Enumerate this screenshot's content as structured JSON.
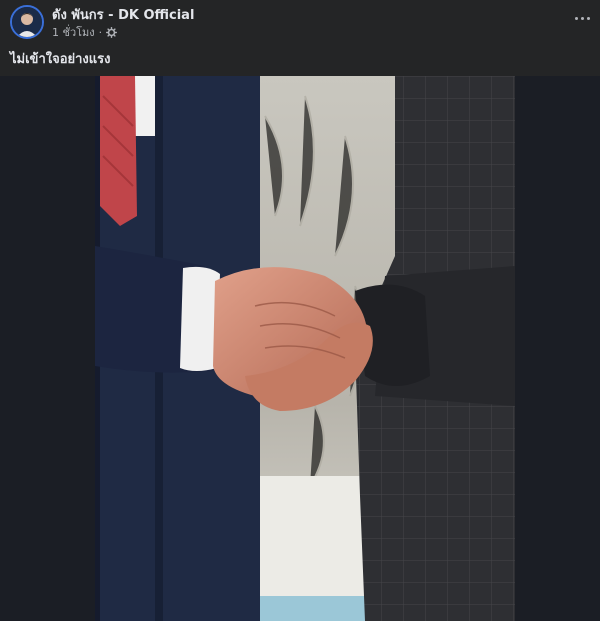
{
  "post": {
    "author": "ดัง พันกร - DK Official",
    "timestamp": "1 ชั่วโมง",
    "separator": "·",
    "privacy_icon": "gear-icon",
    "caption": "ไม่เข้าใจอย่างแรง",
    "more_icon": "more-horizontal-icon",
    "avatar_icon": "avatar"
  },
  "photo": {
    "subject": "handshake-photo",
    "colors": {
      "background": "#1b1e25",
      "left_suit": "#1c2540",
      "right_suit": "#2a2b2e",
      "shirt": "#f0f0f0",
      "skin": "#c9826a",
      "wall": "#c9c7bf",
      "tie": "#c0454a"
    }
  },
  "theme": {
    "surface": "#242526",
    "text_primary": "#e4e6eb",
    "text_secondary": "#b0b3b8",
    "accent": "#3a6fd8"
  }
}
